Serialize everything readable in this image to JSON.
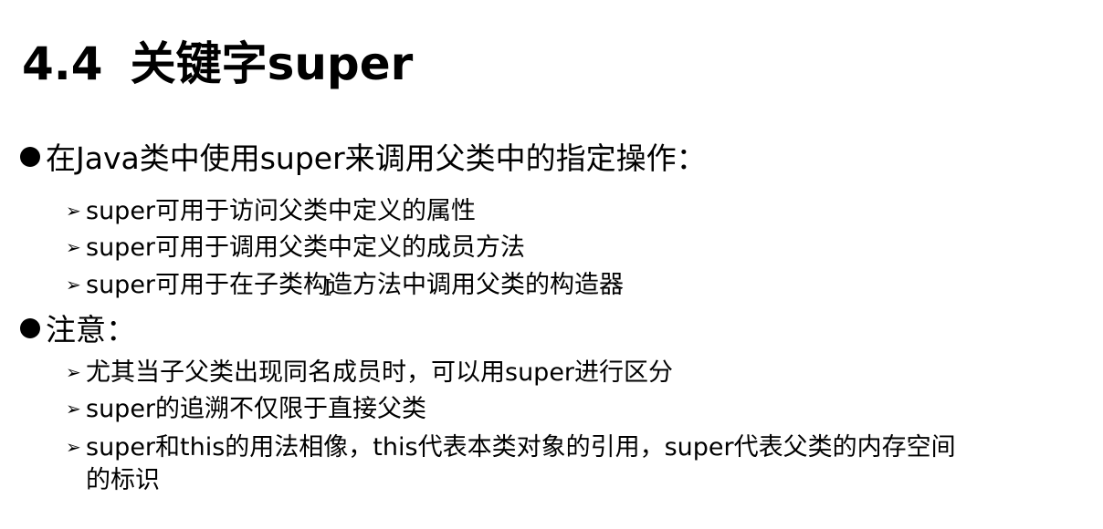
{
  "title": {
    "number": "4.4",
    "text": "关键字super"
  },
  "sections": [
    {
      "bullet": "在Java类中使用super来调用父类中的指定操作：",
      "items": [
        "super可用于访问父类中定义的属性",
        "super可用于调用父类中定义的成员方法",
        "super可用于在子类构造方法中调用父类的构造器"
      ]
    },
    {
      "bullet": "注意：",
      "items": [
        "尤其当子父类出现同名成员时，可以用super进行区分",
        "super的追溯不仅限于直接父类",
        "super和this的用法相像，this代表本类对象的引用，super代表父类的内存空间",
        "的标识"
      ]
    }
  ],
  "icons": {
    "bullet": "filled-circle-bullet",
    "sub_bullet": "arrowhead-bullet"
  }
}
